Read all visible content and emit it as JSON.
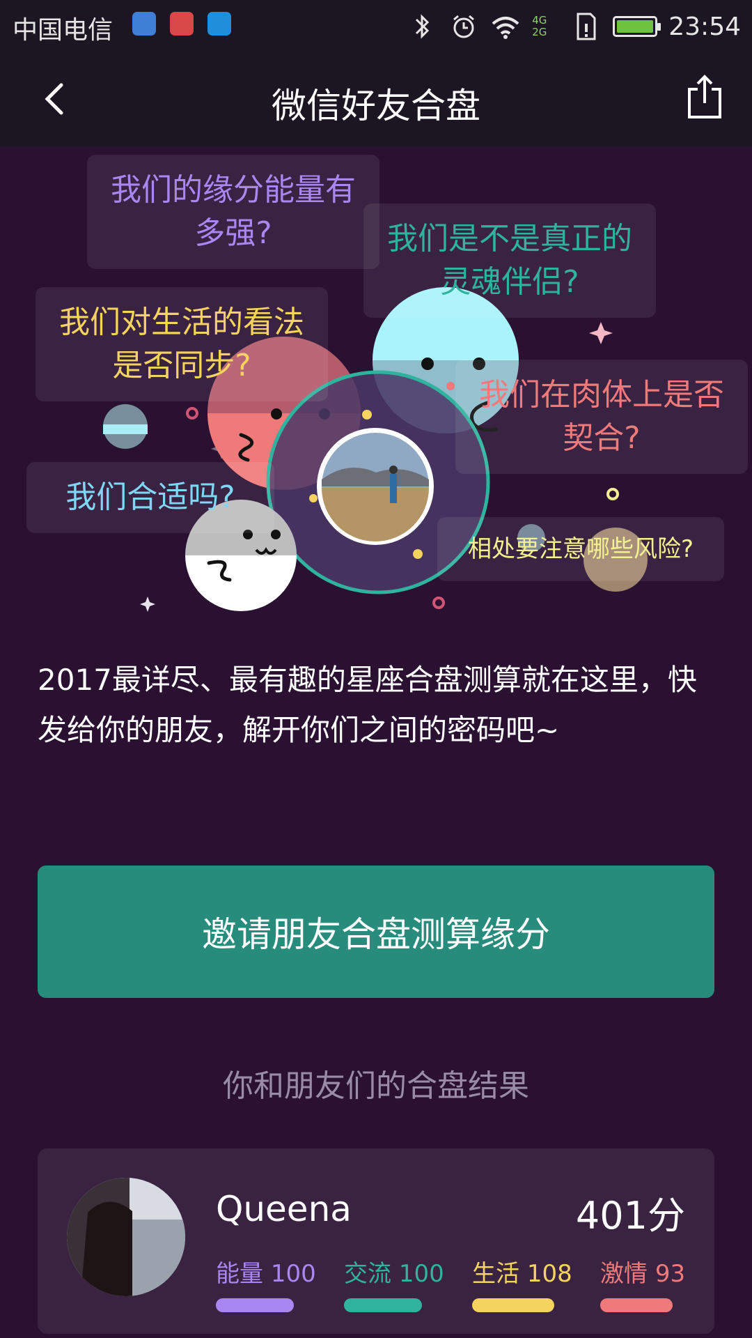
{
  "status_bar": {
    "carrier": "中国电信",
    "network_4g": "4G",
    "network_2g": "2G",
    "time": "23:54",
    "icons": [
      "location-app-icon",
      "bike-app-icon",
      "message-app-icon",
      "bluetooth-icon",
      "alarm-icon",
      "wifi-icon",
      "signal-icon",
      "sim-icon",
      "battery-icon"
    ]
  },
  "header": {
    "title": "微信好友合盘",
    "back_icon": "chevron-left-icon",
    "share_icon": "share-icon"
  },
  "hero": {
    "bubbles": [
      {
        "text": "我们的缘分能量有多强?",
        "color": "#a987f2"
      },
      {
        "text": "我们是不是真正的灵魂伴侣?",
        "color": "#2fb39e"
      },
      {
        "text": "我们对生活的看法是否同步?",
        "color": "#f5d35f"
      },
      {
        "text": "我们在肉体上是否契合?",
        "color": "#f07a7a"
      },
      {
        "text": "我们合适吗?",
        "color": "#7fd7f5"
      },
      {
        "text": "相处要注意哪些风险?",
        "color": "#f3f090"
      }
    ]
  },
  "intro": "2017最详尽、最有趣的星座合盘测算就在这里，快发给你的朋友，解开你们之间的密码吧~",
  "invite_button": "邀请朋友合盘测算缘分",
  "results_heading": "你和朋友们的合盘结果",
  "results": [
    {
      "name": "Queena",
      "score": "401分",
      "metrics": [
        {
          "label": "能量",
          "value": "100",
          "color": "#a987f2",
          "fill": 0.95
        },
        {
          "label": "交流",
          "value": "100",
          "color": "#2fb39e",
          "fill": 0.95
        },
        {
          "label": "生活",
          "value": "108",
          "color": "#f5d35f",
          "fill": 1.0
        },
        {
          "label": "激情",
          "value": "93",
          "color": "#f07a7a",
          "fill": 0.88
        }
      ]
    }
  ]
}
